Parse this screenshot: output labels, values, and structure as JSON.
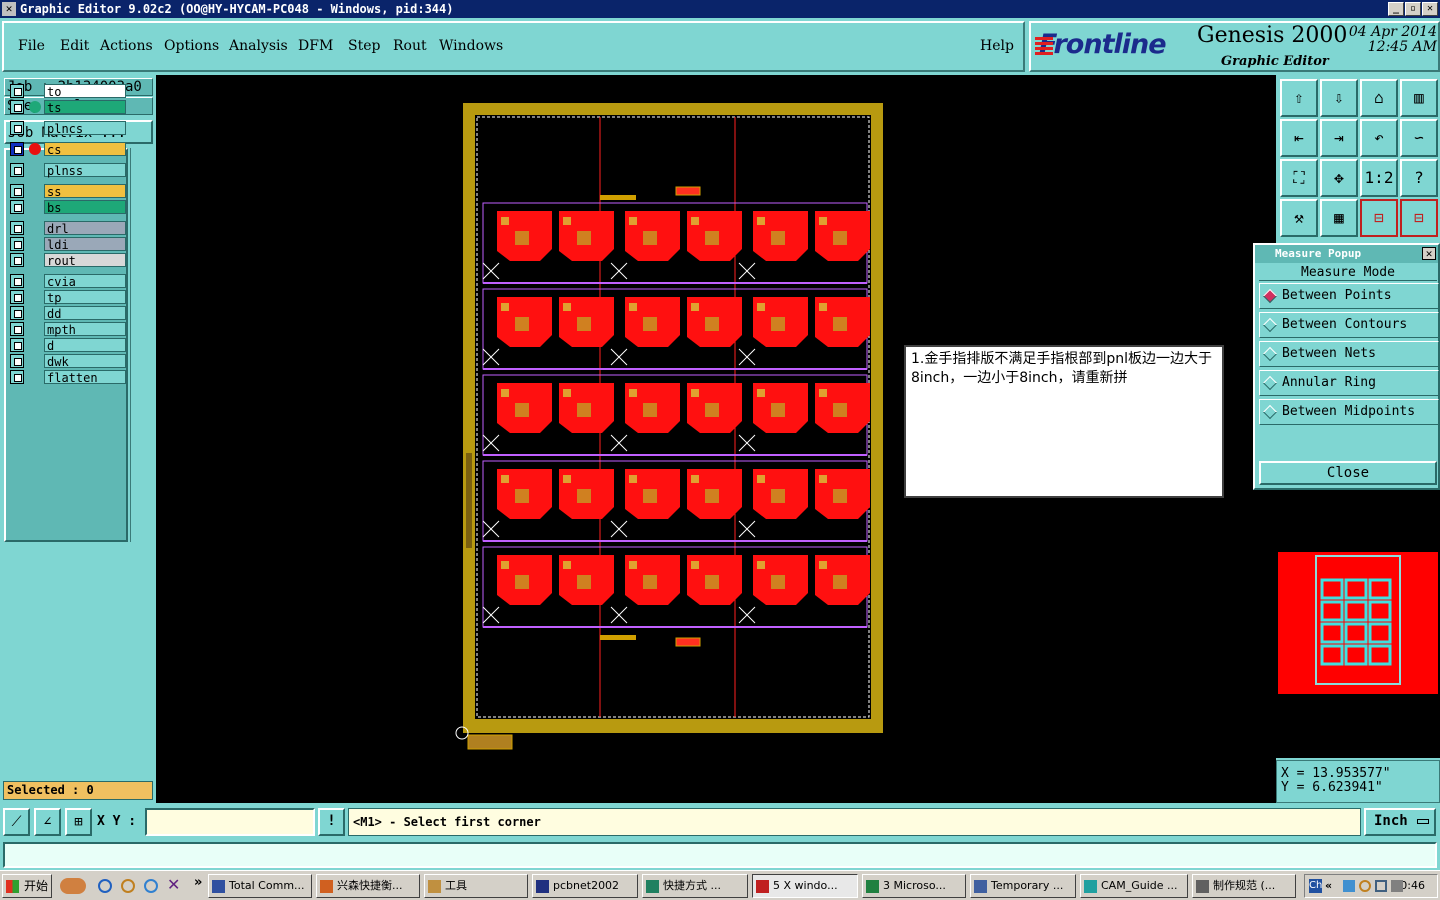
{
  "window": {
    "title": "Graphic Editor 9.02c2 (OO@HY-HYCAM-PC048 - Windows, pid:344)",
    "icon": "x-icon"
  },
  "menu": [
    "File",
    "Edit",
    "Actions",
    "Options",
    "Analysis",
    "DFM",
    "Step",
    "Rout",
    "Windows"
  ],
  "help": "Help",
  "logo": {
    "brand": "Frontline",
    "product": "Genesis 2000",
    "sub": "Graphic Editor",
    "date": "04 Apr 2014",
    "time": "12:45 AM"
  },
  "job": {
    "job": "Job : 2b134003a0",
    "step": "Step: pnl",
    "matrix_btn": "Job Matrix ..."
  },
  "layers": [
    {
      "name": "to",
      "color": "#ffffff",
      "dot": ""
    },
    {
      "name": "ts",
      "color": "#1ea878",
      "dot": "#1ea878"
    },
    {
      "name": "plncs",
      "color": "#7fd6d2",
      "dot": ""
    },
    {
      "name": "cs",
      "color": "#f0c040",
      "dot": "#e81010",
      "active": true
    },
    {
      "name": "plnss",
      "color": "#7fd6d2",
      "dot": ""
    },
    {
      "name": "ss",
      "color": "#f0c040",
      "dot": ""
    },
    {
      "name": "bs",
      "color": "#1ea878",
      "dot": ""
    },
    {
      "name": "drl",
      "color": "#9aa8b8",
      "dot": ""
    },
    {
      "name": "ldi",
      "color": "#9aa8b8",
      "dot": ""
    },
    {
      "name": "rout",
      "color": "#d8d8d8",
      "dot": ""
    },
    {
      "name": "cvia",
      "color": "#7fd6d2",
      "dot": ""
    },
    {
      "name": "tp",
      "color": "#7fd6d2",
      "dot": ""
    },
    {
      "name": "dd",
      "color": "#7fd6d2",
      "dot": ""
    },
    {
      "name": "mpth",
      "color": "#7fd6d2",
      "dot": ""
    },
    {
      "name": "d",
      "color": "#7fd6d2",
      "dot": ""
    },
    {
      "name": "dwk",
      "color": "#7fd6d2",
      "dot": ""
    },
    {
      "name": "flatten",
      "color": "#7fd6d2",
      "dot": ""
    }
  ],
  "selected": "Selected : 0",
  "toolbar_icons": [
    "home-up-icon",
    "home-down-icon",
    "home-icon",
    "split-view-icon",
    "move-left-icon",
    "move-right-icon",
    "undo-step-icon",
    "snake-icon",
    "fit-zoom-icon",
    "center-zoom-icon",
    "ratio-1to1-icon",
    "help-query-icon",
    "tools-icon",
    "grid-icon",
    "layers-icon",
    "layers-active-icon"
  ],
  "toolbar_text": {
    "ratio": "1:2",
    "help": "?"
  },
  "measure": {
    "title": "Measure Popup",
    "mode": "Measure Mode",
    "options": [
      "Between Points",
      "Between Contours",
      "Between Nets",
      "Annular Ring",
      "Between Midpoints"
    ],
    "selected": 0,
    "close": "Close"
  },
  "note": "1.金手指排版不满足手指根部到pnl板边一边大于8inch，一边小于8inch，请重新拼",
  "coords": {
    "x": "X = 13.953577\"",
    "y": "Y = 6.623941\""
  },
  "cmd": {
    "xy_label": "X Y :",
    "xy_value": "",
    "prompt": "<M1> - Select first corner",
    "unit": "Inch",
    "exclaim": "!"
  },
  "taskbar": {
    "start": "开始",
    "more": "»",
    "tasks": [
      "Total Comm...",
      "兴森快捷衡...",
      "工具",
      "pcbnet2002",
      "快捷方式 ...",
      "5 X windo...",
      "3 Microso...",
      "Temporary ...",
      "CAM_Guide ...",
      "制作规范 (..."
    ],
    "tray_lang": "Ch",
    "tray_arrow": "«",
    "time": "0:46"
  },
  "board": {
    "rows": 5,
    "cols": 3,
    "units_per_block": 2
  }
}
